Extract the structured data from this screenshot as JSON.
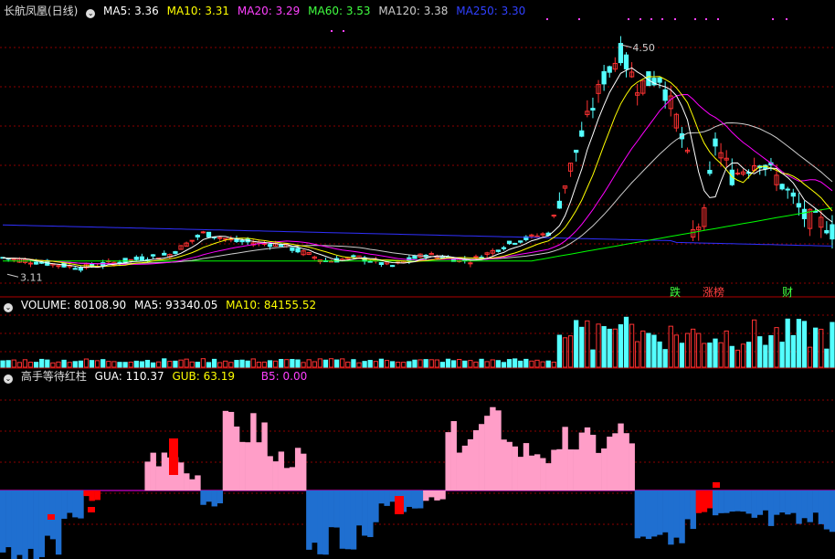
{
  "chart_data": [
    {
      "type": "candlestick",
      "title": "长航凤凰(日线)",
      "indicators": [
        {
          "label": "MA5: 3.36",
          "color": "#ffffff"
        },
        {
          "label": "MA10: 3.31",
          "color": "#ffff00"
        },
        {
          "label": "MA20: 3.29",
          "color": "#ff00ff"
        },
        {
          "label": "MA60: 3.53",
          "color": "#00ff00"
        },
        {
          "label": "MA120: 3.38",
          "color": "#cccccc"
        },
        {
          "label": "MA250: 3.30",
          "color": "#4040ff"
        }
      ],
      "high_label": "4.50",
      "low_label": "3.11",
      "high_value": 4.5,
      "low_value": 3.11,
      "markers": [
        "跌",
        "涨榜",
        "财"
      ],
      "ma5_end": 3.36,
      "ma10_end": 3.31,
      "ma20_end": 3.29,
      "ma60_end": 3.53,
      "ma120_end": 3.38,
      "ma250_end": 3.3
    },
    {
      "type": "bar",
      "title": "VOLUME",
      "indicators": [
        {
          "label": "VOLUME: 80108.90",
          "color": "#ffffff"
        },
        {
          "label": "MA5: 93340.05",
          "color": "#ffffff"
        },
        {
          "label": "MA10: 84155.52",
          "color": "#ffff00"
        }
      ]
    },
    {
      "type": "bar",
      "title": "高手等待红柱",
      "indicators": [
        {
          "label": "GUA: 110.37",
          "color": "#ffffff"
        },
        {
          "label": "GUB: 63.19",
          "color": "#ffff00"
        },
        {
          "label": "B5: 0.00",
          "color": "#ff00ff"
        }
      ]
    }
  ],
  "colors": {
    "up": "#ff3232",
    "down": "#54ffff",
    "ma5": "#ffffff",
    "ma10": "#ffff00",
    "ma20": "#ff00ff",
    "ma60": "#00ff00",
    "ma120": "#cccccc",
    "ma250": "#3030ff",
    "pink": "#ff9ec8",
    "blue": "#1f6fd0",
    "red": "#ff0000",
    "grid": "#8b0000"
  }
}
